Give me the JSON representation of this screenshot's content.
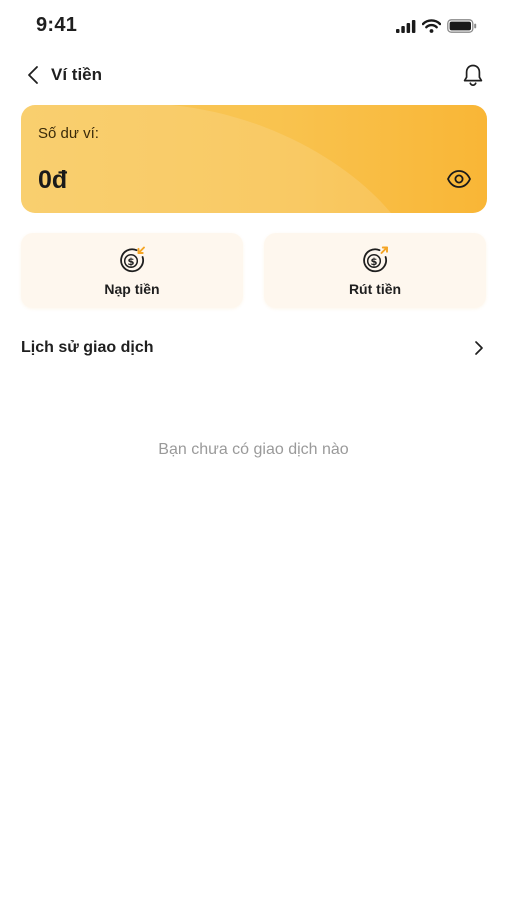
{
  "status_bar": {
    "time": "9:41"
  },
  "header": {
    "title": "Ví tiền"
  },
  "balance_card": {
    "label": "Số dư ví:",
    "value": "0đ"
  },
  "actions": [
    {
      "label": "Nạp tiền",
      "icon": "deposit-dollar-icon"
    },
    {
      "label": "Rút tiền",
      "icon": "withdraw-dollar-icon"
    }
  ],
  "history": {
    "title": "Lịch sử giao dịch",
    "empty_text": "Bạn chưa có giao dịch nào"
  },
  "colors": {
    "card_gradient_start": "#f8c85a",
    "card_gradient_end": "#f9b636",
    "action_bg": "#fef7ee",
    "icon_accent": "#f5a524"
  }
}
